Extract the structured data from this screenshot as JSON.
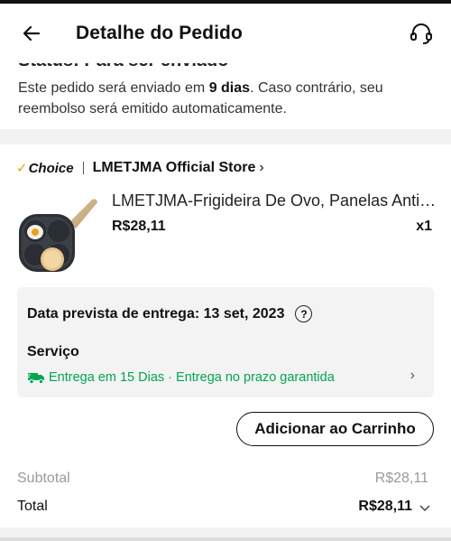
{
  "header": {
    "title": "Detalhe do Pedido",
    "back_icon": "arrow-left-icon",
    "support_icon": "headset-icon"
  },
  "status": {
    "cut_title": "Status: Para ser enviado",
    "msg_prefix": "Este pedido será enviado em ",
    "msg_days": "9 dias",
    "msg_suffix": ". Caso contrário, seu reembolso será emitido automaticamente."
  },
  "store": {
    "badge": "Choice",
    "badge_check": "✓",
    "name": "LMETJMA Official Store",
    "chevron": "›"
  },
  "product": {
    "title": "LMETJMA-Frigideira De Ovo, Panelas Antiaderentes",
    "price": "R$28,11",
    "quantity": "x1"
  },
  "delivery": {
    "eta": "Data prevista de entrega: 13 set, 2023",
    "help": "?",
    "service_label": "Serviço",
    "service_text": "Entrega em 15 Dias · Entrega no prazo garantida",
    "chevron": "›"
  },
  "actions": {
    "add_to_cart": "Adicionar ao Carrinho"
  },
  "summary": {
    "subtotal_label": "Subtotal",
    "subtotal_value": "R$28,11",
    "total_label": "Total",
    "total_value": "R$28,11"
  },
  "colors": {
    "accent_green": "#00a650",
    "choice_check": "#f5a300"
  }
}
